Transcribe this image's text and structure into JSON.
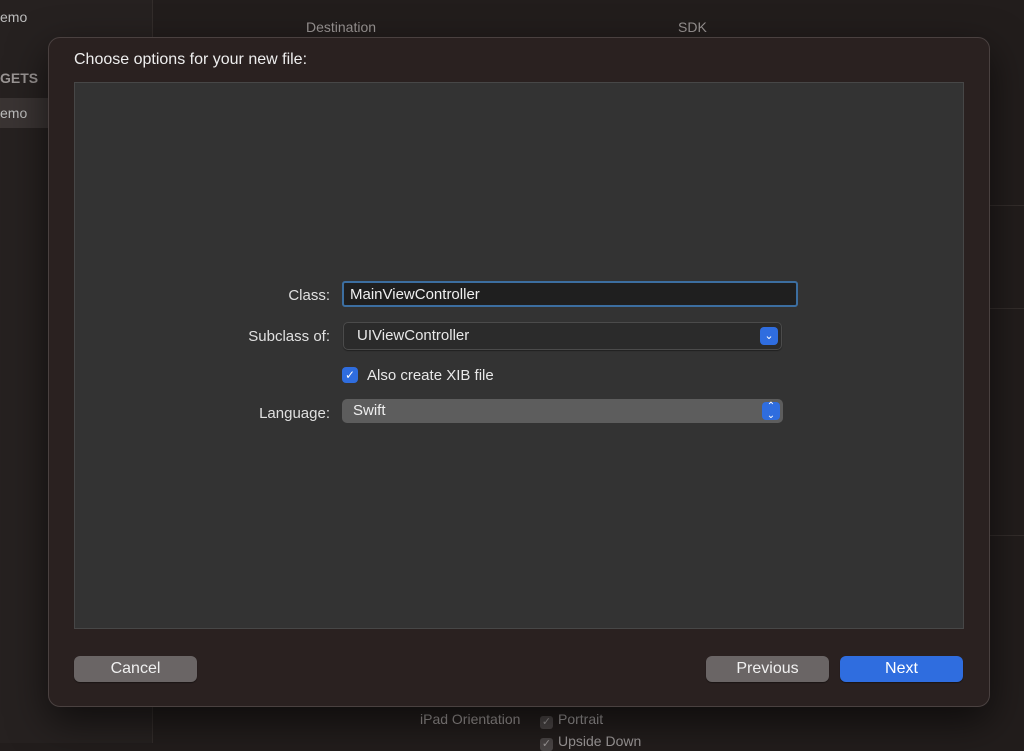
{
  "background": {
    "sidebar_items": [
      "emo",
      "GETS",
      "emo"
    ],
    "column_headers": {
      "destination": "Destination",
      "sdk": "SDK"
    },
    "bottom": {
      "ipad_orientation_label": "iPad Orientation",
      "portrait_label": "Portrait",
      "upside_down_label": "Upside Down"
    }
  },
  "sheet": {
    "title": "Choose options for your new file:",
    "class_label": "Class:",
    "class_value": "MainViewController",
    "subclass_label": "Subclass of:",
    "subclass_value": "UIViewController",
    "xib_checked": true,
    "xib_label": "Also create XIB file",
    "language_label": "Language:",
    "language_value": "Swift"
  },
  "buttons": {
    "cancel": "Cancel",
    "previous": "Previous",
    "next": "Next"
  },
  "colors": {
    "accent": "#2f6ddf",
    "focus_ring": "#3c6ea0"
  }
}
